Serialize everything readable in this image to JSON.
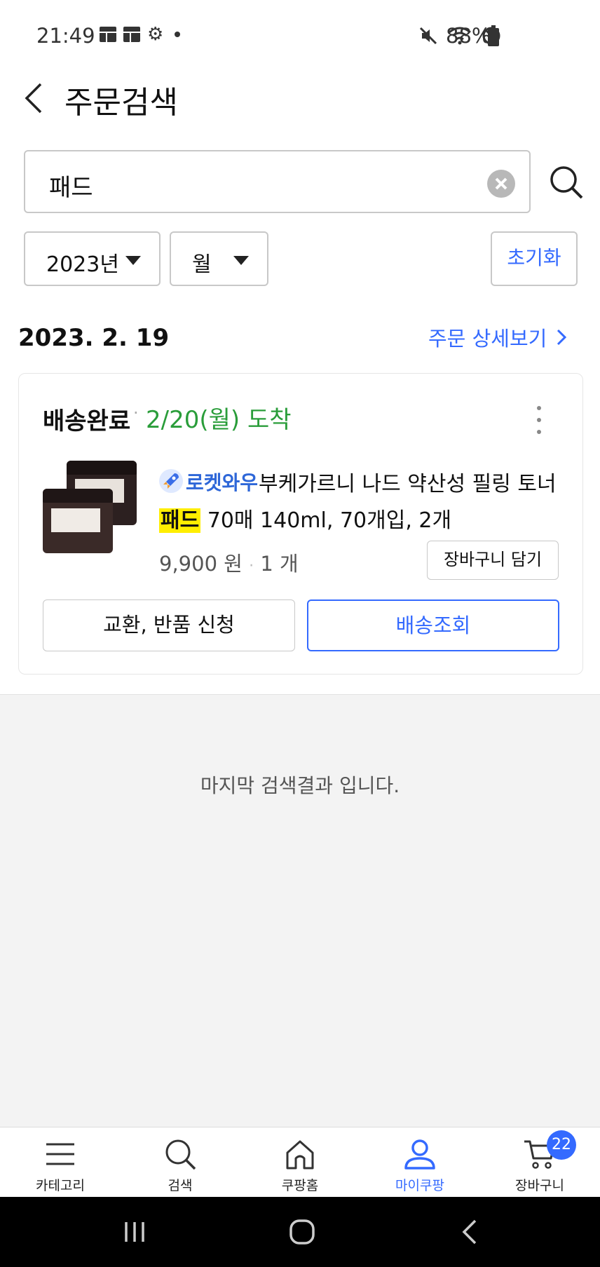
{
  "status_bar": {
    "time": "21:49",
    "battery": "88%",
    "icons_left": [
      "notification-icon",
      "notification-icon",
      "settings-icon",
      "dot-icon"
    ],
    "icons_right": [
      "mute-icon",
      "wifi-icon",
      "do-not-disturb-icon",
      "battery-icon"
    ]
  },
  "header": {
    "title": "주문검색"
  },
  "search": {
    "value": "패드"
  },
  "filters": {
    "year": "2023년",
    "month": "월",
    "reset_label": "초기화"
  },
  "order": {
    "date": "2023. 2. 19",
    "detail_link": "주문 상세보기",
    "status": "배송완료",
    "separator": "·",
    "arrival": "2/20(월) 도착",
    "badge": "로켓와우",
    "product_name_line1": "부케가르니 나드 약산성 필링 토너",
    "product_highlight": "패드",
    "product_name_line2_rest": " 70매 140ml, 70개입, 2개",
    "price": "9,900 원",
    "quantity": "1 개",
    "add_to_cart_label": "장바구니 담기",
    "exchange_label": "교환, 반품 신청",
    "tracking_label": "배송조회"
  },
  "end_message": "마지막 검색결과 입니다.",
  "bottom_nav": {
    "items": [
      {
        "label": "카테고리",
        "icon": "menu-icon"
      },
      {
        "label": "검색",
        "icon": "search-icon"
      },
      {
        "label": "쿠팡홈",
        "icon": "home-icon"
      },
      {
        "label": "마이쿠팡",
        "icon": "person-icon"
      },
      {
        "label": "장바구니",
        "icon": "cart-icon"
      }
    ],
    "active_index": 3,
    "cart_count": "22"
  },
  "colors": {
    "accent": "#346aff",
    "arrival_green": "#2a9d3a",
    "highlight_yellow": "#ffee00"
  }
}
